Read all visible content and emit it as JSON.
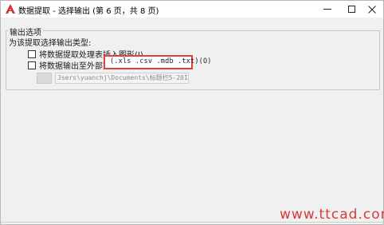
{
  "window": {
    "title": "数据提取 - 选择输出 (第 6 页，共 8 页)",
    "accent": "#e04040"
  },
  "titlebar": {
    "minimize_icon": "minimize-icon",
    "maximize_icon": "maximize-icon",
    "close_icon": "close-icon"
  },
  "output_options": {
    "group_title": "输出选项",
    "description": "为该提取选择输出类型:",
    "insert_table": {
      "label": "将数据提取处理表插入图形(I)",
      "checked": false
    },
    "export_file": {
      "label": "将数据输出至外部文件",
      "checked": false
    },
    "file_types": "(.xls .csv .mdb .txt)(O)",
    "browse_label": "",
    "path_value": "Jsers\\yuanchj\\Documents\\标题栏5-2013.xls"
  },
  "watermark": "www.ttcad.com"
}
